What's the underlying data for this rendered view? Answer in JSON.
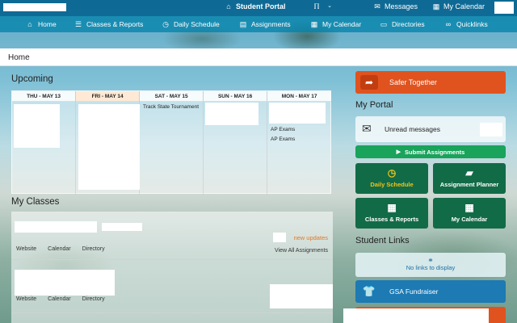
{
  "topbar": {
    "portal_label": "Student Portal",
    "messages_label": "Messages",
    "calendar_label": "My Calendar",
    "icons": [
      "home-icon",
      "logo-icon",
      "envelope-icon",
      "calendar-icon"
    ]
  },
  "nav": {
    "items": [
      {
        "label": "Home",
        "icon": "home-icon"
      },
      {
        "label": "Classes & Reports",
        "icon": "list-icon"
      },
      {
        "label": "Daily Schedule",
        "icon": "clock-icon"
      },
      {
        "label": "Assignments",
        "icon": "book-icon"
      },
      {
        "label": "My Calendar",
        "icon": "calendar-icon"
      },
      {
        "label": "Directories",
        "icon": "id-card-icon"
      },
      {
        "label": "Quicklinks",
        "icon": "link-icon"
      }
    ]
  },
  "breadcrumb": "Home",
  "upcoming": {
    "title": "Upcoming",
    "days": [
      {
        "label": "THU - MAY 13",
        "events": []
      },
      {
        "label": "FRI - MAY 14",
        "events": []
      },
      {
        "label": "SAT - MAY 15",
        "events": [
          "Track State Tournament"
        ]
      },
      {
        "label": "SUN - MAY 16",
        "events": []
      },
      {
        "label": "MON - MAY 17",
        "events": [
          "AP Exams",
          "AP Exams"
        ]
      }
    ]
  },
  "classes": {
    "title": "My Classes",
    "links": [
      "Website",
      "Calendar",
      "Directory"
    ],
    "new_updates": "new updates",
    "view_all": "View All Assignments"
  },
  "sidebar": {
    "safer_together": "Safer Together",
    "my_portal": "My Portal",
    "unread_messages": "Unread messages",
    "submit_assignments": "Submit Assignments",
    "tiles": [
      {
        "label": "Daily Schedule",
        "icon": "clock-icon"
      },
      {
        "label": "Assignment Planner",
        "icon": "bookmark-icon"
      },
      {
        "label": "Classes & Reports",
        "icon": "grid-icon"
      },
      {
        "label": "My Calendar",
        "icon": "calendar-icon"
      }
    ],
    "student_links": "Student Links",
    "no_links": "No links to display",
    "gsa_fundraiser": "GSA Fundraiser"
  },
  "colors": {
    "orange": "#e0531f",
    "green": "#19a35b",
    "dark_green": "#126b47",
    "blue": "#1d7ab3",
    "accent_orange_text": "#e87722"
  }
}
